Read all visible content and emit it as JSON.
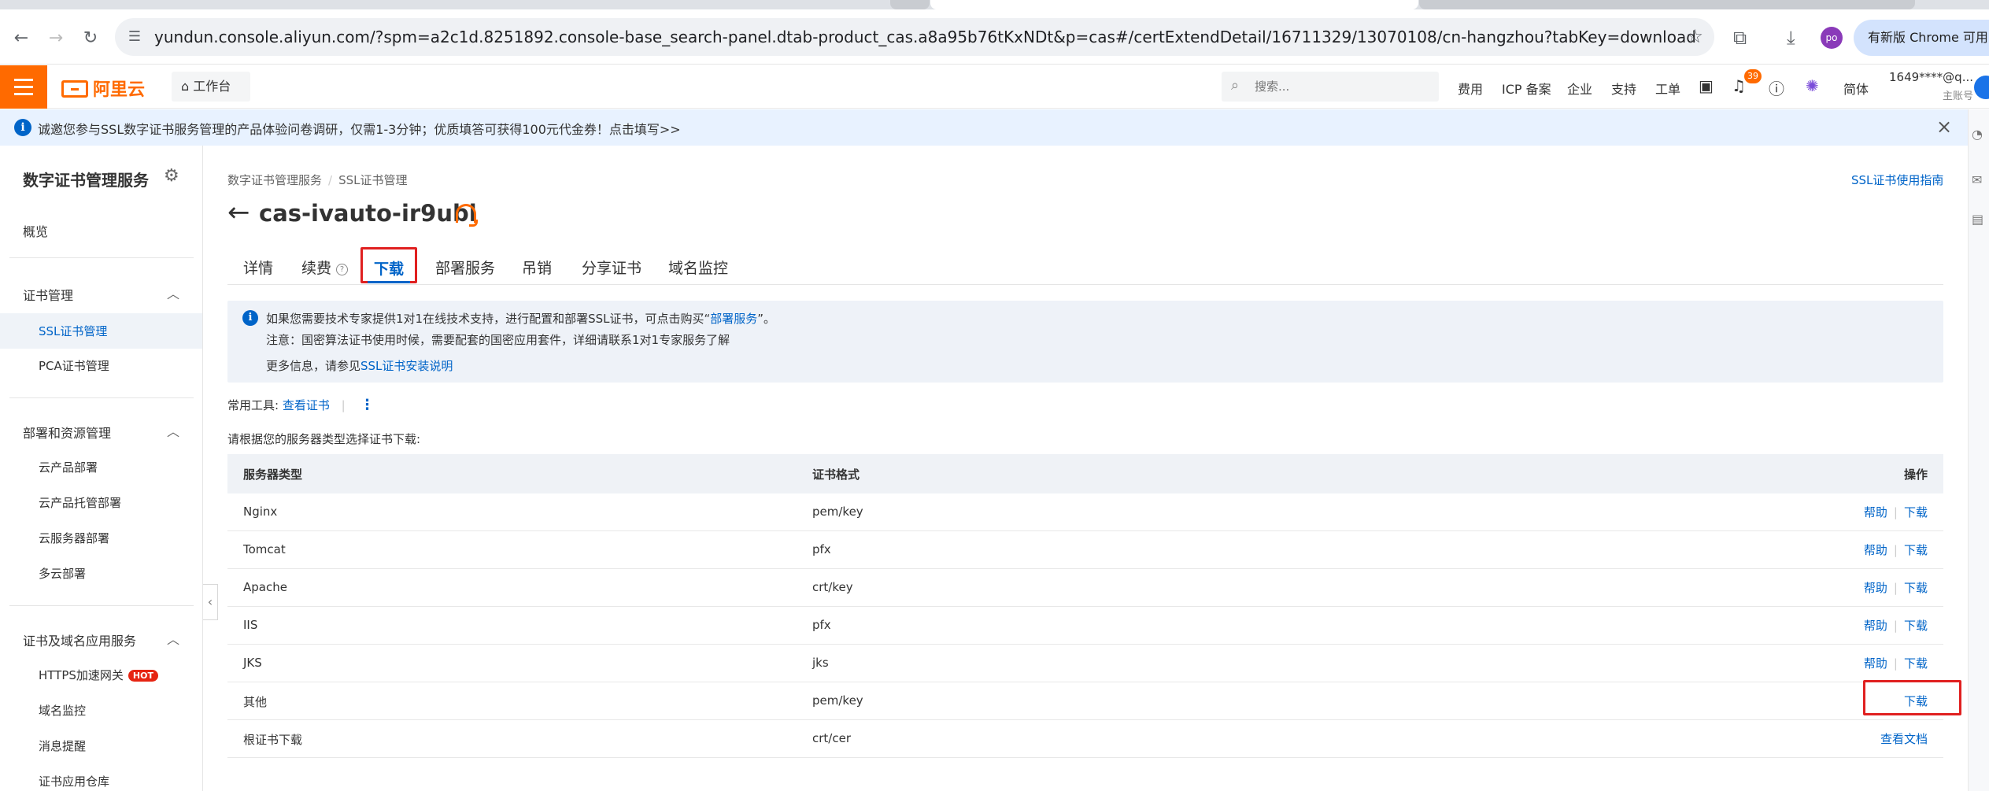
{
  "browser": {
    "url": "yundun.console.aliyun.com/?spm=a2c1d.8251892.console-base_search-panel.dtab-product_cas.a8a95b76tKxNDt&p=cas#/certExtendDetail/16711329/13070108/cn-hangzhou?tabKey=download",
    "profile_initials": "po",
    "new_chrome_label": "有新版 Chrome 可用"
  },
  "topbar": {
    "logo_text": "阿里云",
    "workbench_label": "工作台",
    "search_placeholder": "搜索...",
    "nav": [
      "费用",
      "ICP 备案",
      "企业",
      "支持",
      "工单"
    ],
    "notification_count": "39",
    "language": "简体",
    "account_name": "1649****@q...",
    "account_role": "主账号"
  },
  "notice": {
    "text": "诚邀您参与SSL数字证书服务管理的产品体验问卷调研，仅需1-3分钟；优质填答可获得100元代金券！点击填写>>"
  },
  "sidebar": {
    "title": "数字证书管理服务",
    "overview": "概览",
    "group1": {
      "label": "证书管理",
      "items": [
        "SSL证书管理",
        "PCA证书管理"
      ]
    },
    "group2": {
      "label": "部署和资源管理",
      "items": [
        "云产品部署",
        "云产品托管部署",
        "云服务器部署",
        "多云部署"
      ]
    },
    "group3": {
      "label": "证书及域名应用服务",
      "items": [
        "HTTPS加速网关",
        "域名监控",
        "消息提醒",
        "证书应用仓库"
      ],
      "hot_badge": "HOT"
    }
  },
  "main": {
    "breadcrumb": [
      "数字证书管理服务",
      "SSL证书管理"
    ],
    "guide_link": "SSL证书使用指南",
    "title": "cas-ivauto-ir9ubl",
    "tabs": [
      "详情",
      "续费",
      "下载",
      "部署服务",
      "吊销",
      "分享证书",
      "域名监控"
    ],
    "info": {
      "line1_prefix": "如果您需要技术专家提供1对1在线技术支持，进行配置和部署SSL证书，可点击购买“",
      "line1_link": "部署服务",
      "line1_suffix": "”。",
      "line2": "注意：国密算法证书使用时候，需要配套的国密应用套件，详细请联系1对1专家服务了解",
      "line3_prefix": "更多信息，请参见",
      "line3_link": "SSL证书安装说明"
    },
    "tools_label": "常用工具:",
    "tools_link": "查看证书",
    "instruction": "请根据您的服务器类型选择证书下载:",
    "table": {
      "headers": [
        "服务器类型",
        "证书格式",
        "操作"
      ],
      "rows": [
        {
          "server": "Nginx",
          "format": "pem/key",
          "help": "帮助",
          "action": "下载"
        },
        {
          "server": "Tomcat",
          "format": "pfx",
          "help": "帮助",
          "action": "下载"
        },
        {
          "server": "Apache",
          "format": "crt/key",
          "help": "帮助",
          "action": "下载"
        },
        {
          "server": "IIS",
          "format": "pfx",
          "help": "帮助",
          "action": "下载"
        },
        {
          "server": "JKS",
          "format": "jks",
          "help": "帮助",
          "action": "下载"
        },
        {
          "server": "其他",
          "format": "pem/key",
          "help": "",
          "action": "下载"
        },
        {
          "server": "根证书下载",
          "format": "crt/cer",
          "help": "",
          "action": "查看文档"
        }
      ]
    }
  },
  "colors": {
    "brand": "#ff6a00",
    "link": "#0064c8",
    "highlight": "#e02020"
  }
}
